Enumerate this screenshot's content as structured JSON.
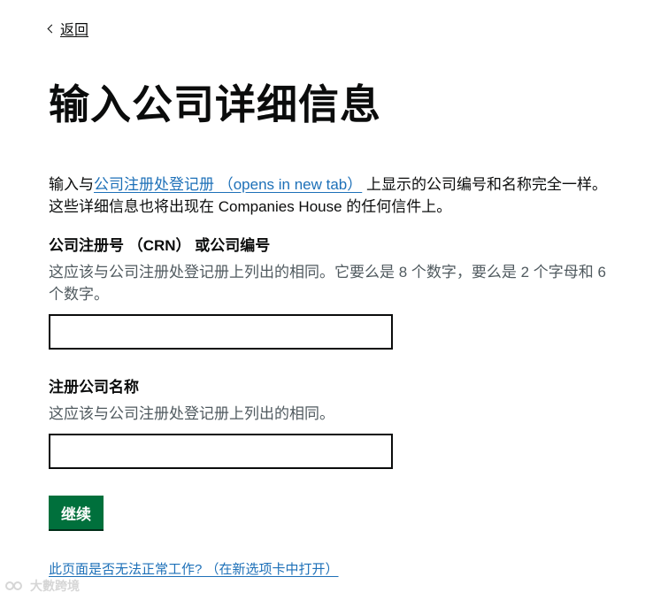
{
  "back": {
    "label": "返回"
  },
  "page_title": "输入公司详细信息",
  "intro": {
    "before": "输入与",
    "link": "公司注册处登记册 （opens in new tab）",
    "after": " 上显示的公司编号和名称完全一样。 这些详细信息也将出现在 Companies House 的任何信件上。"
  },
  "crn_field": {
    "label": "公司注册号 （CRN） 或公司编号",
    "hint": "这应该与公司注册处登记册上列出的相同。它要么是 8 个数字，要么是 2 个字母和 6 个数字。",
    "value": "",
    "placeholder": ""
  },
  "name_field": {
    "label": "注册公司名称",
    "hint": "这应该与公司注册处登记册上列出的相同。",
    "value": "",
    "placeholder": ""
  },
  "continue_button": {
    "label": "继续"
  },
  "problem_link": {
    "label": "此页面是否无法正常工作? （在新选项卡中打开）"
  },
  "watermark": {
    "text": "大數跨境"
  },
  "colors": {
    "link": "#1d70b8",
    "button": "#00703c",
    "text": "#0b0c0c",
    "hint": "#505a5f"
  }
}
